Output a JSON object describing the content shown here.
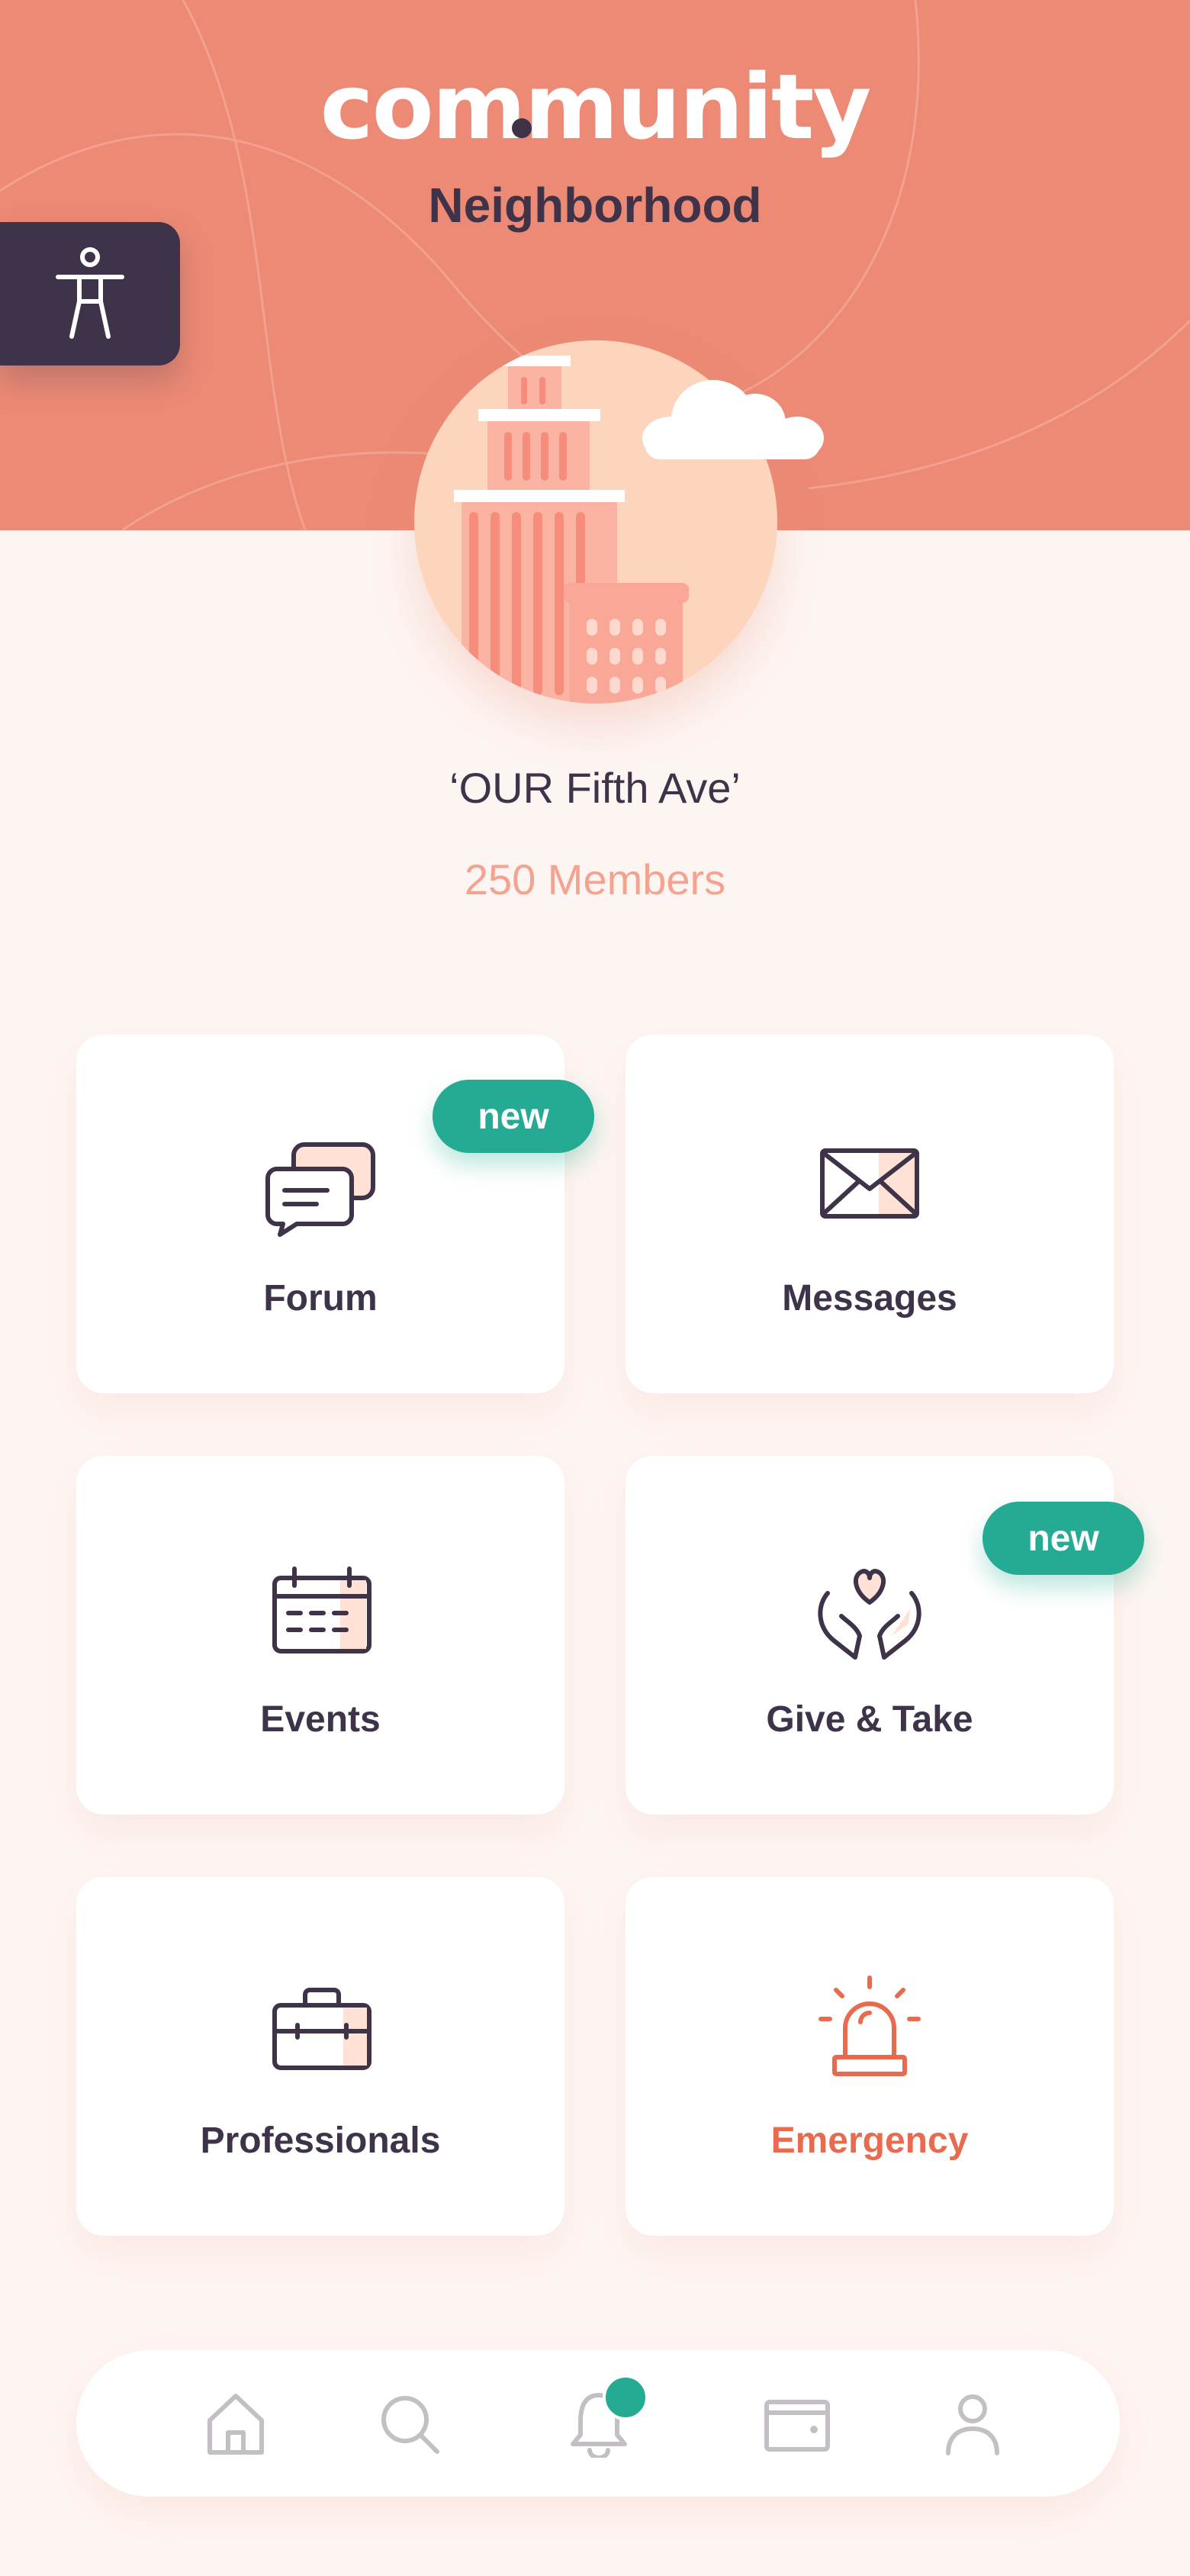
{
  "header": {
    "logo": "community",
    "subtitle": "Neighborhood"
  },
  "community": {
    "name": "‘OUR Fifth Ave’",
    "members": "250 Members"
  },
  "tiles": [
    {
      "label": "Forum",
      "badge": "new",
      "icon": "chat-bubbles-icon"
    },
    {
      "label": "Messages",
      "badge": "",
      "icon": "envelope-icon"
    },
    {
      "label": "Events",
      "badge": "",
      "icon": "calendar-icon"
    },
    {
      "label": "Give & Take",
      "badge": "new",
      "icon": "hands-heart-icon"
    },
    {
      "label": "Professionals",
      "badge": "",
      "icon": "briefcase-icon"
    },
    {
      "label": "Emergency",
      "badge": "",
      "icon": "siren-icon"
    }
  ],
  "nav": {
    "items": [
      "home-icon",
      "search-icon",
      "bell-icon",
      "wallet-icon",
      "user-icon"
    ],
    "has_notification": true
  },
  "colors": {
    "header": "#ec8a75",
    "accent": "#25ab93",
    "dark": "#3e3348",
    "emergency": "#e86b4f",
    "background": "#fdf5f2"
  }
}
